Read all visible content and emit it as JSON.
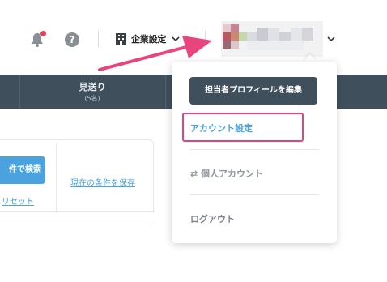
{
  "header": {
    "corporate_settings_label": "企業設定",
    "help_symbol": "?"
  },
  "nav": {
    "tab_label": "見送り",
    "tab_count": "(5名)"
  },
  "search_panel": {
    "search_button_label": "件で検索",
    "reset_link_label": "リセット",
    "save_condition_link_label": "現在の条件を保存"
  },
  "user_menu": {
    "edit_profile_button_label": "担当者プロフィールを編集",
    "account_settings_label": "アカウント設定",
    "personal_account_label": "個人アカウント",
    "logout_label": "ログアウト"
  },
  "icons": {
    "notification": "bell-icon",
    "help": "help-icon",
    "building": "building-icon",
    "chevron": "chevron-down-icon",
    "switch": "swap-icon"
  },
  "colors": {
    "nav_background": "#3f4f5c",
    "accent_blue": "#4aa3df",
    "highlight_pink": "#e0457b",
    "notification_dot": "#e2435a"
  }
}
